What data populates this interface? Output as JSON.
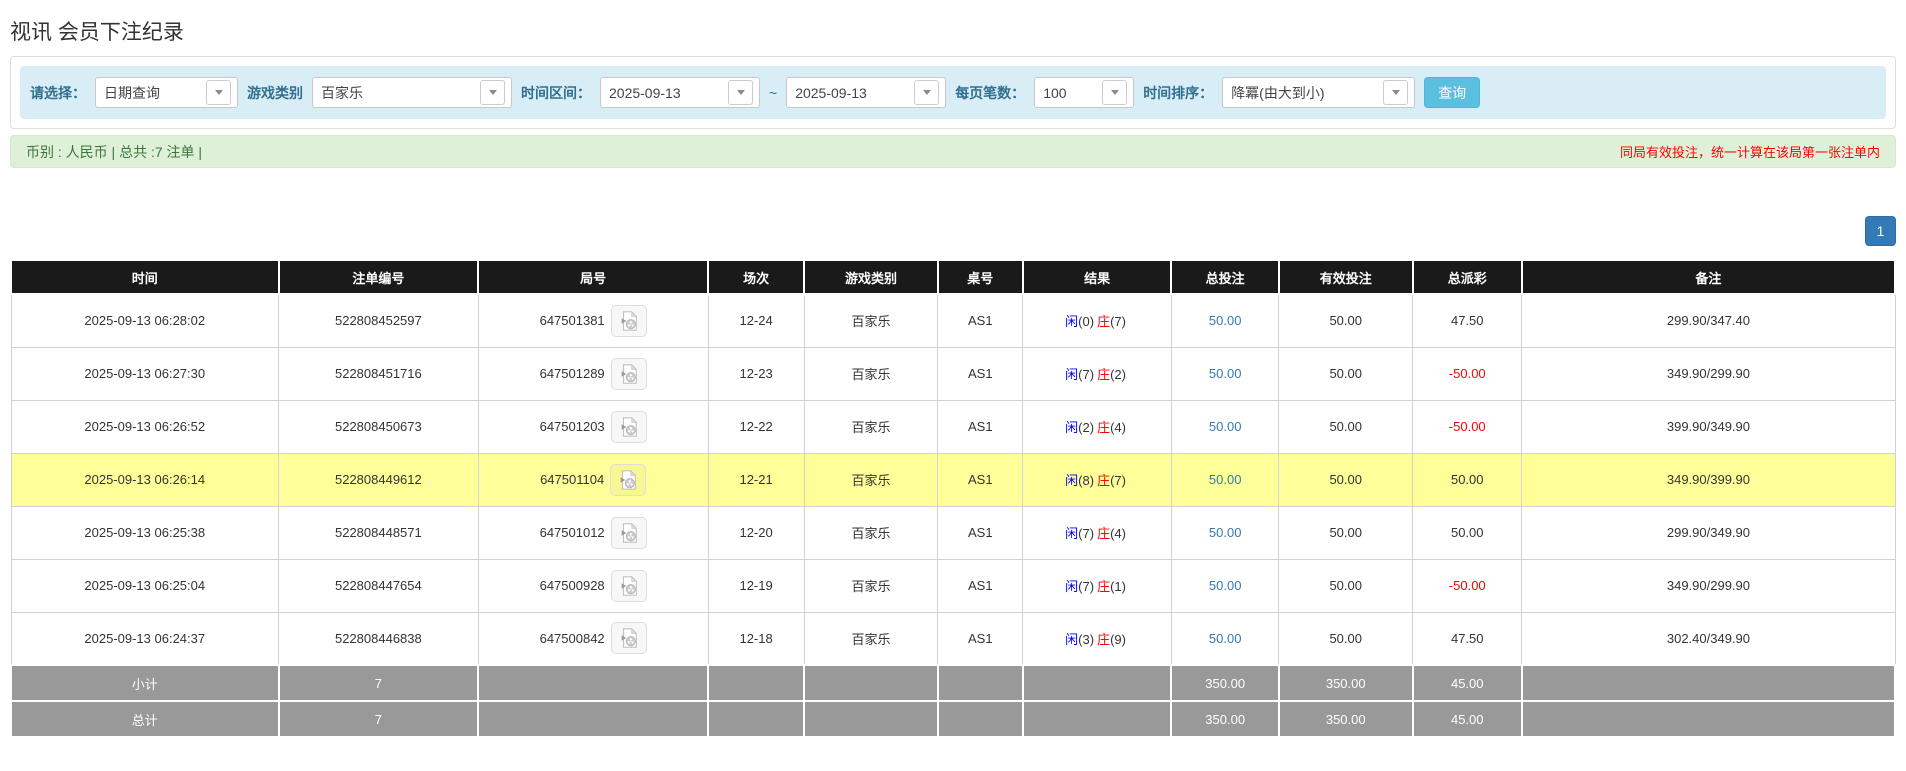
{
  "page_title": "视讯 会员下注纪录",
  "filters": {
    "select_label": "请选择：",
    "select_value": "日期查询",
    "game_type_label": "游戏类别",
    "game_type_value": "百家乐",
    "date_range_label": "时间区间：",
    "date_from": "2025-09-13",
    "tilde": "~",
    "date_to": "2025-09-13",
    "page_size_label": "每页笔数：",
    "page_size_value": "100",
    "sort_label": "时间排序：",
    "sort_value": "降冪(由大到小)",
    "search_button_label": "查询"
  },
  "summary": {
    "left_text": "币别 : 人民币 | 总共 :7 注单 |",
    "right_notice": "同局有效投注，统一计算在该局第一张注单内"
  },
  "pagination": {
    "current_page": "1"
  },
  "table": {
    "headers": [
      "时间",
      "注单编号",
      "局号",
      "场次",
      "游戏类别",
      "桌号",
      "结果",
      "总投注",
      "有效投注",
      "总派彩",
      "备注"
    ],
    "result_player_label": "闲",
    "result_banker_label": "庄",
    "video_icon": "video-replay-icon",
    "rows": [
      {
        "time": "2025-09-13 06:28:02",
        "bet_id": "522808452597",
        "round_id": "647501381",
        "session": "12-24",
        "game": "百家乐",
        "table_no": "AS1",
        "player": "0",
        "banker": "7",
        "total_bet": "50.00",
        "valid_bet": "50.00",
        "payout": "47.50",
        "remark": "299.90/347.40",
        "highlight": false
      },
      {
        "time": "2025-09-13 06:27:30",
        "bet_id": "522808451716",
        "round_id": "647501289",
        "session": "12-23",
        "game": "百家乐",
        "table_no": "AS1",
        "player": "7",
        "banker": "2",
        "total_bet": "50.00",
        "valid_bet": "50.00",
        "payout": "-50.00",
        "remark": "349.90/299.90",
        "highlight": false
      },
      {
        "time": "2025-09-13 06:26:52",
        "bet_id": "522808450673",
        "round_id": "647501203",
        "session": "12-22",
        "game": "百家乐",
        "table_no": "AS1",
        "player": "2",
        "banker": "4",
        "total_bet": "50.00",
        "valid_bet": "50.00",
        "payout": "-50.00",
        "remark": "399.90/349.90",
        "highlight": false
      },
      {
        "time": "2025-09-13 06:26:14",
        "bet_id": "522808449612",
        "round_id": "647501104",
        "session": "12-21",
        "game": "百家乐",
        "table_no": "AS1",
        "player": "8",
        "banker": "7",
        "total_bet": "50.00",
        "valid_bet": "50.00",
        "payout": "50.00",
        "remark": "349.90/399.90",
        "highlight": true
      },
      {
        "time": "2025-09-13 06:25:38",
        "bet_id": "522808448571",
        "round_id": "647501012",
        "session": "12-20",
        "game": "百家乐",
        "table_no": "AS1",
        "player": "7",
        "banker": "4",
        "total_bet": "50.00",
        "valid_bet": "50.00",
        "payout": "50.00",
        "remark": "299.90/349.90",
        "highlight": false
      },
      {
        "time": "2025-09-13 06:25:04",
        "bet_id": "522808447654",
        "round_id": "647500928",
        "session": "12-19",
        "game": "百家乐",
        "table_no": "AS1",
        "player": "7",
        "banker": "1",
        "total_bet": "50.00",
        "valid_bet": "50.00",
        "payout": "-50.00",
        "remark": "349.90/299.90",
        "highlight": false
      },
      {
        "time": "2025-09-13 06:24:37",
        "bet_id": "522808446838",
        "round_id": "647500842",
        "session": "12-18",
        "game": "百家乐",
        "table_no": "AS1",
        "player": "3",
        "banker": "9",
        "total_bet": "50.00",
        "valid_bet": "50.00",
        "payout": "47.50",
        "remark": "302.40/349.90",
        "highlight": false
      }
    ],
    "footer": [
      {
        "label": "小计",
        "count": "7",
        "total_bet": "350.00",
        "valid_bet": "350.00",
        "payout": "45.00"
      },
      {
        "label": "总计",
        "count": "7",
        "total_bet": "350.00",
        "valid_bet": "350.00",
        "payout": "45.00"
      }
    ]
  },
  "colors": {
    "filter_bg": "#d9edf7",
    "filter_label": "#31708f",
    "search_button": "#5bc0de",
    "summary_bg": "#dff0d8",
    "notice_red": "#ff0000",
    "accent_blue": "#337ab7",
    "header_bg": "#1a1a1a",
    "footer_bg": "#999999",
    "highlight_row": "#ffff99",
    "player_blue": "#0000ff",
    "banker_red": "#ff0000",
    "negative_red": "#ff0000"
  }
}
